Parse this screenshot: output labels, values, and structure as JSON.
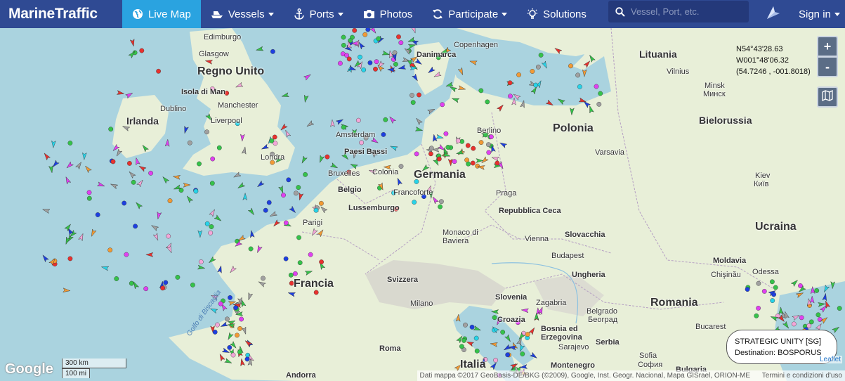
{
  "nav": {
    "logo": "MarineTraffic",
    "items": [
      {
        "label": "Live Map",
        "icon": "globe-icon"
      },
      {
        "label": "Vessels",
        "icon": "ship-icon"
      },
      {
        "label": "Ports",
        "icon": "anchor-icon"
      },
      {
        "label": "Photos",
        "icon": "camera-icon"
      },
      {
        "label": "Participate",
        "icon": "sync-icon"
      },
      {
        "label": "Solutions",
        "icon": "lightbulb-icon"
      }
    ],
    "search_placeholder": "Vessel, Port, etc.",
    "sign_in": "Sign in",
    "accent": "#2aa3e0",
    "bar_color": "#2f4a93"
  },
  "map": {
    "coords": {
      "lat": "N54°43'28.63",
      "lon": "W001°48'06.32",
      "decimal": "(54.7246 , -001.8018)"
    },
    "zoom_in": "+",
    "zoom_out": "-",
    "popup": {
      "name": "STRATEGIC UNITY [SG]",
      "destination": "Destination: BOSPORUS"
    },
    "scale": {
      "km": "300 km",
      "mi": "100 mi"
    },
    "attribution": "Dati mappa ©2017 GeoBasis-DE/BKG (©2009), Google, Inst. Geogr. Nacional, Mapa GISrael, ORION-ME",
    "terms": "Termini e condizioni d'uso",
    "google": "Google",
    "leaflet": "Leaflet",
    "countries": [
      "Regno Unito",
      "Irlanda",
      "Francia",
      "Germania",
      "Polonia",
      "Lituania",
      "Bielorussia",
      "Ucraina",
      "Romania",
      "Italia",
      "Belgio",
      "Paesi Bassi",
      "Danimarca",
      "Repubblica Ceca",
      "Slovacchia",
      "Ungheria",
      "Svizzera",
      "Slovenia",
      "Croazia",
      "Bosnia ed Erzegovina",
      "Serbia",
      "Montenegro",
      "Bulgaria",
      "Moldavia",
      "Lussemburgo",
      "Isola di Man"
    ],
    "cities": [
      "Edimburgo",
      "Glasgow",
      "Dublino",
      "Manchester",
      "Liverpool",
      "Londra",
      "Parigi",
      "Bruxelles",
      "Colonia",
      "Amsterdam",
      "Francoforte",
      "Praga",
      "Berlino",
      "Varsavia",
      "Vilnius",
      "Minsk",
      "Минск",
      "Kiev",
      "Київ",
      "Monaco di Baviera",
      "Vienna",
      "Budapest",
      "Milano",
      "Zagabria",
      "Belgrado",
      "Београд",
      "Bucarest",
      "Chişinău",
      "Odessa",
      "Sarajevo",
      "Sofia",
      "София",
      "Roma",
      "Copenhagen",
      "Andorra",
      "Golfo di Biscaglia"
    ]
  }
}
